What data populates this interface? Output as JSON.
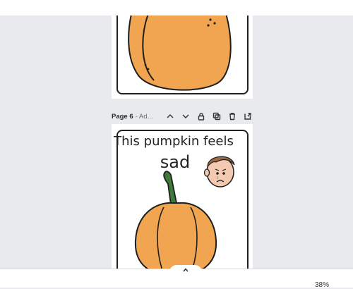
{
  "page_header": {
    "label": "Page 6",
    "sub": "- Ad...",
    "icons": [
      "chevron-up-icon",
      "chevron-down-icon",
      "lock-icon",
      "duplicate-icon",
      "trash-icon",
      "add-page-icon"
    ]
  },
  "page6": {
    "title_line1": "This pumpkin feels",
    "title_line2": "sad"
  },
  "footer": {
    "zoom": "38%"
  },
  "colors": {
    "pumpkin": "#f2a550",
    "pumpkin_outline": "#1e1e1e",
    "stem": "#3e7a3a",
    "skin": "#f3c9b1",
    "hair": "#9b6a44",
    "canvas_bg": "#e9eaee"
  }
}
